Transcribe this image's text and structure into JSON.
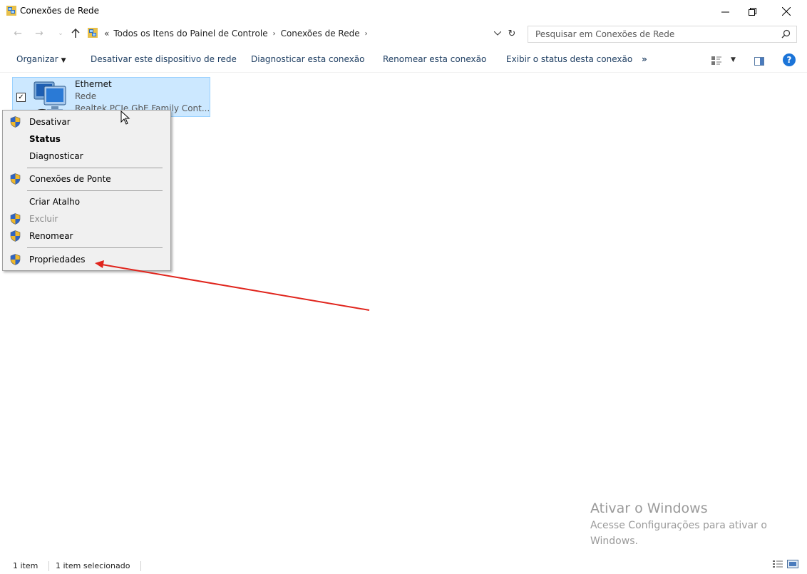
{
  "window": {
    "title": "Conexões de Rede"
  },
  "address": {
    "crumbs": [
      "Todos os Itens do Painel de Controle",
      "Conexões de Rede"
    ],
    "overflow_glyph": "«"
  },
  "search": {
    "placeholder": "Pesquisar em Conexões de Rede"
  },
  "toolbar": {
    "organize": "Organizar",
    "disable": "Desativar este dispositivo de rede",
    "diagnose": "Diagnosticar esta conexão",
    "rename": "Renomear esta conexão",
    "status": "Exibir o status desta conexão",
    "more": "»",
    "help": "?"
  },
  "connection": {
    "name": "Ethernet",
    "type": "Rede",
    "adapter": "Realtek PCIe GbE Family Cont...",
    "checked": true
  },
  "context_menu": {
    "items": [
      {
        "label": "Desativar",
        "icon": "shield-icon",
        "state": "normal"
      },
      {
        "label": "Status",
        "icon": "",
        "state": "bold"
      },
      {
        "label": "Diagnosticar",
        "icon": "",
        "state": "normal"
      },
      {
        "label": "Conexões de Ponte",
        "icon": "shield-icon",
        "state": "normal"
      },
      {
        "label": "Criar Atalho",
        "icon": "",
        "state": "normal"
      },
      {
        "label": "Excluir",
        "icon": "shield-icon",
        "state": "disabled"
      },
      {
        "label": "Renomear",
        "icon": "shield-icon",
        "state": "normal"
      },
      {
        "label": "Propriedades",
        "icon": "shield-icon",
        "state": "normal"
      }
    ]
  },
  "annotation": {
    "color": "#e0241c"
  },
  "watermark": {
    "title": "Ativar o Windows",
    "subtitle": "Acesse Configurações para ativar o Windows."
  },
  "status_bar": {
    "item_count": "1 item",
    "selected": "1 item selecionado"
  }
}
